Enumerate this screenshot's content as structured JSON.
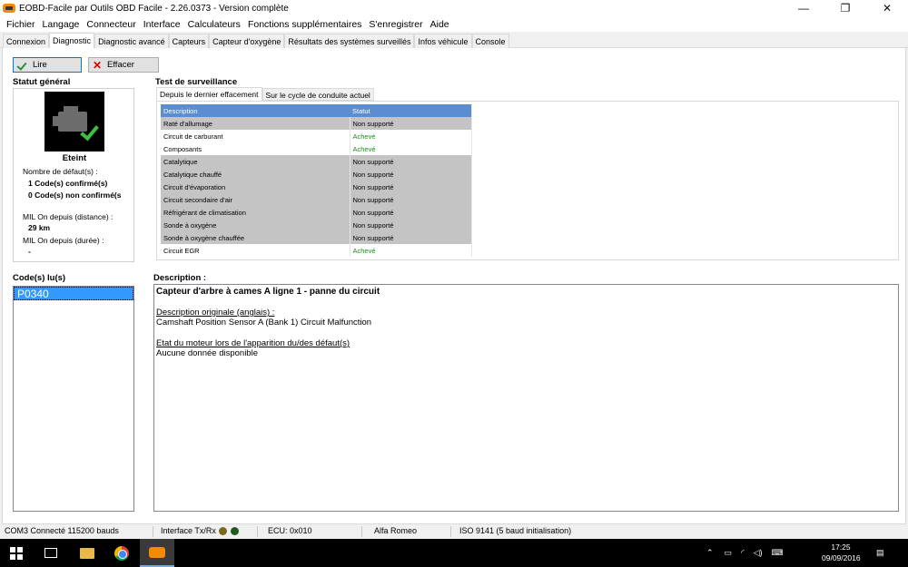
{
  "window": {
    "title": "EOBD-Facile par Outils OBD Facile - 2.26.0373 - Version complète",
    "minimize": "—",
    "restore": "❐",
    "close": "✕"
  },
  "menu": [
    "Fichier",
    "Langage",
    "Connecteur",
    "Interface",
    "Calculateurs",
    "Fonctions supplémentaires",
    "S'enregistrer",
    "Aide"
  ],
  "tabs": [
    "Connexion",
    "Diagnostic",
    "Diagnostic avancé",
    "Capteurs",
    "Capteur d'oxygène",
    "Résultats des systèmes surveillés",
    "Infos véhicule",
    "Console"
  ],
  "active_tab": "Diagnostic",
  "toolbar": {
    "read_label": "Lire",
    "clear_label": "Effacer"
  },
  "status": {
    "heading": "Statut général",
    "state": "Eteint",
    "fault_count_label": "Nombre de défaut(s) :",
    "confirmed": "1 Code(s) confirmé(s)",
    "unconfirmed": "0 Code(s) non confirmé(s",
    "mil_distance_label": "MIL On depuis (distance) :",
    "mil_distance_value": "29 km",
    "mil_duration_label": "MIL On depuis (durée) :",
    "mil_duration_value": "-"
  },
  "surveillance": {
    "heading": "Test de surveillance",
    "tabs": [
      "Depuis le dernier effacement",
      "Sur le cycle de conduite actuel"
    ],
    "columns": [
      "Description",
      "Statut"
    ],
    "rows": [
      {
        "description": "Raté d'allumage",
        "status": "Non supporté"
      },
      {
        "description": "Circuit de carburant",
        "status": "Achevé"
      },
      {
        "description": "Composants",
        "status": "Achevé"
      },
      {
        "description": "Catalytique",
        "status": "Non supporté"
      },
      {
        "description": "Catalytique chauffé",
        "status": "Non supporté"
      },
      {
        "description": "Circuit d'évaporation",
        "status": "Non supporté"
      },
      {
        "description": "Circuit secondaire d'air",
        "status": "Non supporté"
      },
      {
        "description": "Réfrigérant de climatisation",
        "status": "Non supporté"
      },
      {
        "description": "Sonde à oxygène",
        "status": "Non supporté"
      },
      {
        "description": "Sonde à oxygène chauffée",
        "status": "Non supporté"
      },
      {
        "description": "Circuit EGR",
        "status": "Achevé"
      }
    ]
  },
  "codes": {
    "heading": "Code(s) lu(s)",
    "items": [
      "P0340"
    ]
  },
  "description": {
    "heading": "Description :",
    "title": "Capteur d'arbre à cames A ligne 1 - panne du circuit",
    "original_label": "Description originale (anglais) :",
    "original_text": "Camshaft Position Sensor A (Bank 1) Circuit Malfunction",
    "engine_state_label": "Etat du moteur lors de l'apparition du/des défaut(s)",
    "engine_state_text": "Aucune donnée disponible"
  },
  "statusbar": {
    "port": "COM3 Connecté 115200 bauds",
    "interface": "Interface Tx/Rx",
    "ecu": "ECU: 0x010",
    "make": "Alfa Romeo",
    "protocol": "ISO 9141 (5 baud initialisation)"
  },
  "taskbar": {
    "time": "17:25",
    "date": "09/09/2016"
  },
  "colors": {
    "selection": "#3399ff",
    "header_blue": "#5b8ed1",
    "row_gray": "#c4c4c4",
    "ok_green": "#1a8f1a",
    "led_tx": "#7a6a20",
    "led_rx": "#1e5a1e"
  }
}
